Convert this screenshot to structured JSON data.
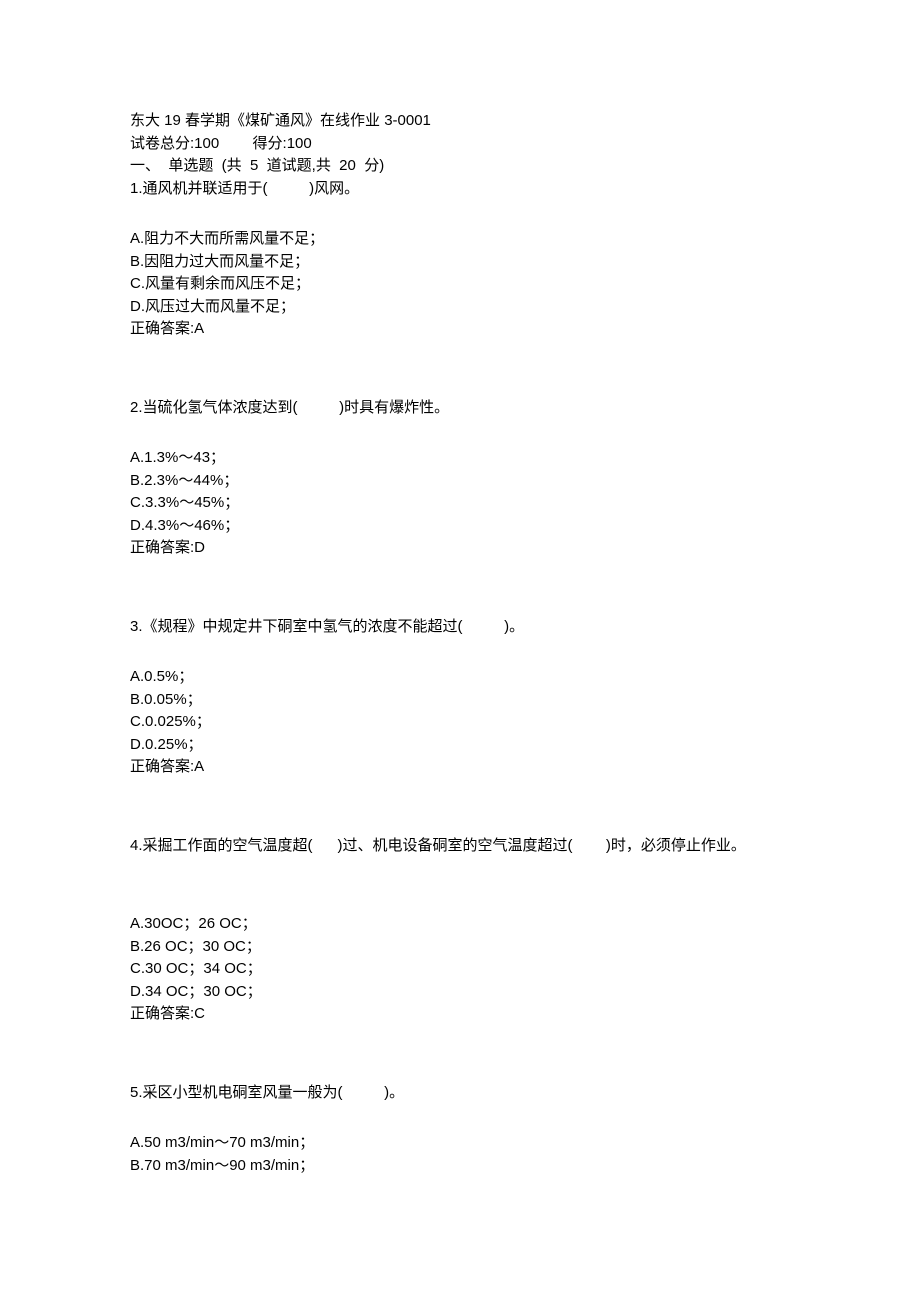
{
  "header": {
    "title": "东大 19 春学期《煤矿通风》在线作业 3-0001",
    "score_line": "试卷总分:100        得分:100",
    "section_line": "一、  单选题  (共  5  道试题,共  20  分)"
  },
  "questions": [
    {
      "prompt": "1.通风机并联适用于(          )风网。",
      "options": [
        "A.阻力不大而所需风量不足；",
        "B.因阻力过大而风量不足；",
        "C.风量有剩余而风压不足；",
        "D.风压过大而风量不足；"
      ],
      "answer": "正确答案:A"
    },
    {
      "prompt": "2.当硫化氢气体浓度达到(          )时具有爆炸性。",
      "options": [
        "A.1.3%～43；",
        "B.2.3%～44%；",
        "C.3.3%～45%；",
        "D.4.3%～46%；"
      ],
      "answer": "正确答案:D"
    },
    {
      "prompt": "3.《规程》中规定井下硐室中氢气的浓度不能超过(          )。",
      "options": [
        "A.0.5%；",
        "B.0.05%；",
        "C.0.025%；",
        "D.0.25%；"
      ],
      "answer": "正确答案:A"
    },
    {
      "prompt": "4.采掘工作面的空气温度超(      )过、机电设备硐室的空气温度超过(        )时，必须停止作业。",
      "options": [
        "A.30OC；26 OC；",
        "B.26 OC；30 OC；",
        "C.30 OC；34 OC；",
        "D.34 OC；30 OC；"
      ],
      "answer": "正确答案:C"
    },
    {
      "prompt": "5.采区小型机电硐室风量一般为(          )。",
      "options": [
        "A.50 m3/min～70 m3/min；",
        "B.70 m3/min～90 m3/min；"
      ],
      "answer": ""
    }
  ]
}
